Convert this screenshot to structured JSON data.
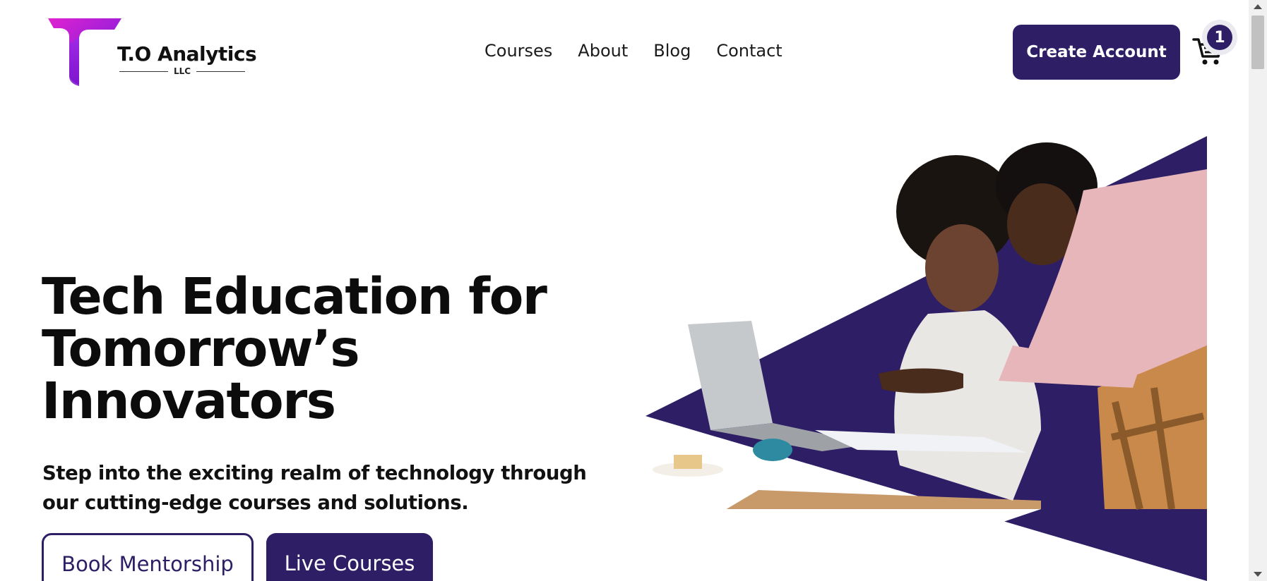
{
  "brand": {
    "name": "T.O Analytics",
    "suffix": "LLC"
  },
  "nav": {
    "items": [
      {
        "label": "Courses"
      },
      {
        "label": "About"
      },
      {
        "label": "Blog"
      },
      {
        "label": "Contact"
      }
    ]
  },
  "header": {
    "create_account_label": "Create Account",
    "cart_count": "1"
  },
  "hero": {
    "title": "Tech Education for Tomorrow’s Innovators",
    "subtitle": "Step into the exciting realm of technology through our cutting-edge courses and solutions.",
    "book_mentorship_label": "Book Mentorship",
    "live_courses_label": "Live Courses"
  },
  "colors": {
    "brand_primary": "#2d1e66",
    "logo_gradient_start": "#d01fd6",
    "logo_gradient_end": "#7a1ee0"
  },
  "icons": {
    "cart": "shopping-cart-icon",
    "logo": "letter-t-logo-icon"
  }
}
